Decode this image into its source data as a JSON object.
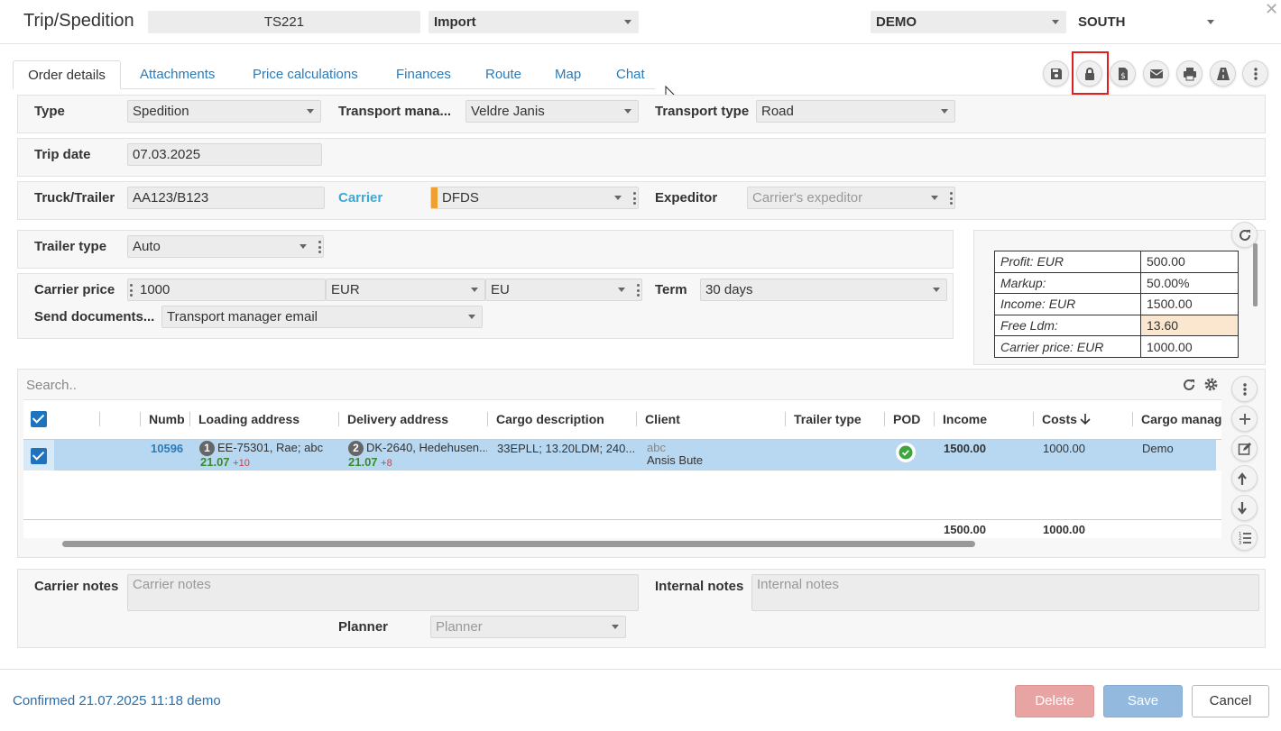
{
  "header": {
    "title": "Trip/Spedition",
    "trip_number": "TS221",
    "direction": "Import",
    "company": "DEMO",
    "region": "SOUTH"
  },
  "tabs": [
    {
      "label": "Order details"
    },
    {
      "label": "Attachments"
    },
    {
      "label": "Price calculations"
    },
    {
      "label": "Finances"
    },
    {
      "label": "Route"
    },
    {
      "label": "Map"
    },
    {
      "label": "Chat"
    }
  ],
  "toolbar": {
    "icons": [
      "save-icon",
      "lock-icon",
      "invoice-icon",
      "email-icon",
      "print-icon",
      "road-icon",
      "more-vertical-icon"
    ],
    "highlight_color": "#e02020"
  },
  "form": {
    "type_label": "Type",
    "type_value": "Spedition",
    "transport_manager_label": "Transport mana...",
    "transport_manager_value": "Veldre Janis",
    "transport_type_label": "Transport type",
    "transport_type_value": "Road",
    "trip_date_label": "Trip date",
    "trip_date_value": "07.03.2025",
    "truck_label": "Truck/Trailer",
    "truck_value": "AA123/B123",
    "carrier_label": "Carrier",
    "carrier_value": "DFDS",
    "expeditor_label": "Expeditor",
    "expeditor_placeholder": "Carrier's expeditor",
    "trailer_type_label": "Trailer type",
    "trailer_type_value": "Auto",
    "carrier_price_label": "Carrier price",
    "carrier_price_value": "1000",
    "currency_value": "EUR",
    "region_value": "EU",
    "term_label": "Term",
    "term_value": "30 days",
    "send_documents_label": "Send documents...",
    "send_documents_value": "Transport manager email"
  },
  "summary": [
    {
      "label": "Profit: EUR",
      "value": "500.00"
    },
    {
      "label": "Markup:",
      "value": "50.00%"
    },
    {
      "label": "Income: EUR",
      "value": "1500.00"
    },
    {
      "label": "Free Ldm:",
      "value": "13.60"
    },
    {
      "label": "Carrier price: EUR",
      "value": "1000.00"
    }
  ],
  "grid": {
    "search_placeholder": "Search..",
    "columns": [
      "Numbe",
      "Loading address",
      "Delivery address",
      "Cargo description",
      "Client",
      "Trailer type",
      "POD",
      "Income",
      "Costs",
      "Cargo manager"
    ],
    "row": {
      "number": "10596",
      "loading_idx": "1",
      "loading_address": "EE-75301, Rae; abc",
      "loading_date": "21.07",
      "loading_offset": "+10",
      "delivery_idx": "2",
      "delivery_address": "DK-2640, Hedehusen...",
      "delivery_date": "21.07",
      "delivery_offset": "+8",
      "cargo_description": "33EPLL; 13.20LDM; 240...",
      "client_code": "abc",
      "client_name": "Ansis Bute",
      "income": "1500.00",
      "costs": "1000.00",
      "cargo_manager": "Demo"
    },
    "totals": {
      "income": "1500.00",
      "costs": "1000.00"
    }
  },
  "notes": {
    "carrier_notes_label": "Carrier notes",
    "carrier_notes_placeholder": "Carrier notes",
    "internal_notes_label": "Internal notes",
    "internal_notes_placeholder": "Internal notes",
    "planner_label": "Planner",
    "planner_placeholder": "Planner"
  },
  "footer": {
    "status": "Confirmed 21.07.2025 11:18 demo",
    "delete_label": "Delete",
    "save_label": "Save",
    "cancel_label": "Cancel"
  }
}
